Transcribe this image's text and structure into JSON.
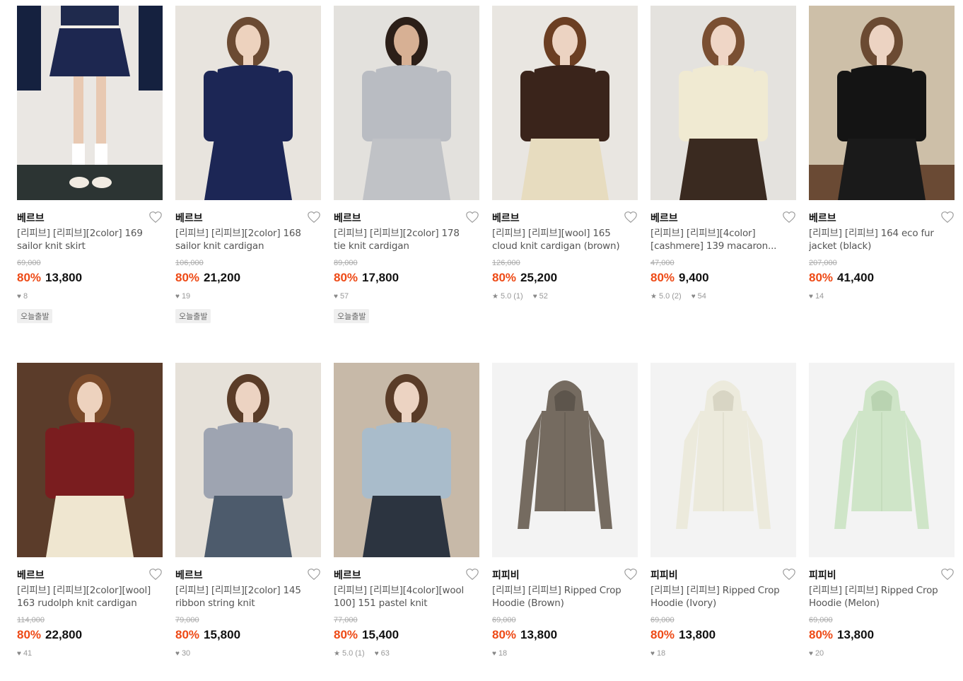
{
  "products": [
    {
      "brand": "베르브",
      "title": "[리피브] [리피브][2color] 169 sailor knit skirt",
      "original_price": "69,000",
      "discount": "80%",
      "price": "13,800",
      "rating": "",
      "reviews": "",
      "likes": "8",
      "tag": "오늘출발",
      "image": "sailor-knit-skirt-photo",
      "bg": "#eae7e3"
    },
    {
      "brand": "베르브",
      "title": "[리피브] [리피브][2color] 168 sailor knit cardigan",
      "original_price": "106,000",
      "discount": "80%",
      "price": "21,200",
      "rating": "",
      "reviews": "",
      "likes": "19",
      "tag": "오늘출발",
      "image": "sailor-knit-cardigan-photo",
      "bg": "#e8e4de"
    },
    {
      "brand": "베르브",
      "title": "[리피브] [리피브][2color] 178 tie knit cardigan",
      "original_price": "89,000",
      "discount": "80%",
      "price": "17,800",
      "rating": "",
      "reviews": "",
      "likes": "57",
      "tag": "오늘출발",
      "image": "tie-knit-cardigan-photo",
      "bg": "#e3e1dd"
    },
    {
      "brand": "베르브",
      "title": "[리피브] [리피브][wool] 165 cloud knit cardigan (brown)",
      "original_price": "126,000",
      "discount": "80%",
      "price": "25,200",
      "rating": "5.0",
      "reviews": "(1)",
      "likes": "52",
      "tag": "",
      "image": "cloud-knit-cardigan-photo",
      "bg": "#e9e6e1"
    },
    {
      "brand": "베르브",
      "title": "[리피브] [리피브][4color][cashmere] 139 macaron...",
      "original_price": "47,000",
      "discount": "80%",
      "price": "9,400",
      "rating": "5.0",
      "reviews": "(2)",
      "likes": "54",
      "tag": "",
      "image": "macaron-knit-photo",
      "bg": "#e4e2de"
    },
    {
      "brand": "베르브",
      "title": "[리피브] [리피브] 164 eco fur jacket (black)",
      "original_price": "207,000",
      "discount": "80%",
      "price": "41,400",
      "rating": "",
      "reviews": "",
      "likes": "14",
      "tag": "",
      "image": "eco-fur-jacket-photo",
      "bg": "#cdbfa8"
    },
    {
      "brand": "베르브",
      "title": "[리피브] [리피브][2color][wool] 163 rudolph knit cardigan",
      "original_price": "114,000",
      "discount": "80%",
      "price": "22,800",
      "rating": "",
      "reviews": "",
      "likes": "41",
      "tag": "",
      "image": "rudolph-knit-cardigan-photo",
      "bg": "#5b3c2a"
    },
    {
      "brand": "베르브",
      "title": "[리피브] [리피브][2color] 145 ribbon string knit",
      "original_price": "79,000",
      "discount": "80%",
      "price": "15,800",
      "rating": "",
      "reviews": "",
      "likes": "30",
      "tag": "",
      "image": "ribbon-string-knit-photo",
      "bg": "#e6e1d9"
    },
    {
      "brand": "베르브",
      "title": "[리피브] [리피브][4color][wool 100] 151 pastel knit",
      "original_price": "77,000",
      "discount": "80%",
      "price": "15,400",
      "rating": "5.0",
      "reviews": "(1)",
      "likes": "63",
      "tag": "",
      "image": "pastel-knit-photo",
      "bg": "#c7b9a8"
    },
    {
      "brand": "피피비",
      "title": "[리피브] [리피브] Ripped Crop Hoodie (Brown)",
      "original_price": "69,000",
      "discount": "80%",
      "price": "13,800",
      "rating": "",
      "reviews": "",
      "likes": "18",
      "tag": "",
      "image": "hoodie-brown-photo",
      "bg": "#f3f3f3"
    },
    {
      "brand": "피피비",
      "title": "[리피브] [리피브] Ripped Crop Hoodie (Ivory)",
      "original_price": "69,000",
      "discount": "80%",
      "price": "13,800",
      "rating": "",
      "reviews": "",
      "likes": "18",
      "tag": "",
      "image": "hoodie-ivory-photo",
      "bg": "#f3f3f3"
    },
    {
      "brand": "피피비",
      "title": "[리피브] [리피브] Ripped Crop Hoodie (Melon)",
      "original_price": "69,000",
      "discount": "80%",
      "price": "13,800",
      "rating": "",
      "reviews": "",
      "likes": "20",
      "tag": "",
      "image": "hoodie-melon-photo",
      "bg": "#f3f3f3"
    }
  ],
  "colors": {
    "discount": "#ee4a16",
    "strike": "#aaaaaa",
    "meta": "#999999"
  }
}
